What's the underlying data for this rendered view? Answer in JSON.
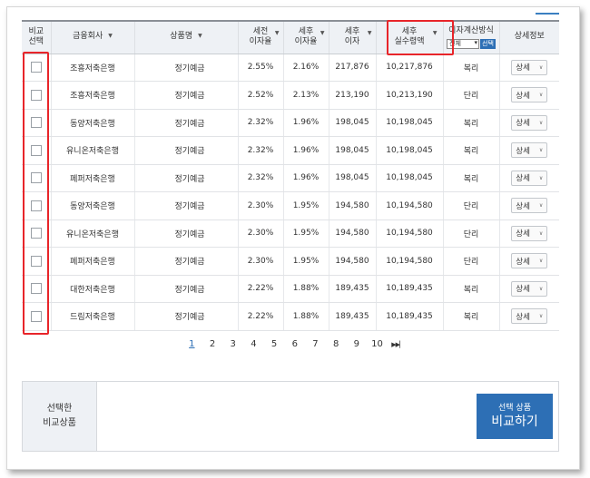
{
  "table": {
    "headers": {
      "compare": [
        "비교",
        "선택"
      ],
      "bank": "금융회사",
      "product": "상품명",
      "pretax_rate": [
        "세전",
        "이자율"
      ],
      "aftertax_rate": [
        "세후",
        "이자율"
      ],
      "aftertax_interest": [
        "세후",
        "이자"
      ],
      "aftertax_received": [
        "세후",
        "실수령액"
      ],
      "calc_method": "이자계산방식",
      "calc_select_value": "전체",
      "calc_select_button": "선택",
      "detail": "상세정보"
    },
    "rows": [
      {
        "bank": "조흥저축은행",
        "product": "정기예금",
        "pretax": "2.55%",
        "aftertax": "2.16%",
        "interest": "217,876",
        "received": "10,217,876",
        "method": "복리",
        "detail": "상세"
      },
      {
        "bank": "조흥저축은행",
        "product": "정기예금",
        "pretax": "2.52%",
        "aftertax": "2.13%",
        "interest": "213,190",
        "received": "10,213,190",
        "method": "단리",
        "detail": "상세"
      },
      {
        "bank": "동양저축은행",
        "product": "정기예금",
        "pretax": "2.32%",
        "aftertax": "1.96%",
        "interest": "198,045",
        "received": "10,198,045",
        "method": "복리",
        "detail": "상세"
      },
      {
        "bank": "유니온저축은행",
        "product": "정기예금",
        "pretax": "2.32%",
        "aftertax": "1.96%",
        "interest": "198,045",
        "received": "10,198,045",
        "method": "복리",
        "detail": "상세"
      },
      {
        "bank": "페퍼저축은행",
        "product": "정기예금",
        "pretax": "2.32%",
        "aftertax": "1.96%",
        "interest": "198,045",
        "received": "10,198,045",
        "method": "복리",
        "detail": "상세"
      },
      {
        "bank": "동양저축은행",
        "product": "정기예금",
        "pretax": "2.30%",
        "aftertax": "1.95%",
        "interest": "194,580",
        "received": "10,194,580",
        "method": "단리",
        "detail": "상세"
      },
      {
        "bank": "유니온저축은행",
        "product": "정기예금",
        "pretax": "2.30%",
        "aftertax": "1.95%",
        "interest": "194,580",
        "received": "10,194,580",
        "method": "단리",
        "detail": "상세"
      },
      {
        "bank": "페퍼저축은행",
        "product": "정기예금",
        "pretax": "2.30%",
        "aftertax": "1.95%",
        "interest": "194,580",
        "received": "10,194,580",
        "method": "단리",
        "detail": "상세"
      },
      {
        "bank": "대한저축은행",
        "product": "정기예금",
        "pretax": "2.22%",
        "aftertax": "1.88%",
        "interest": "189,435",
        "received": "10,189,435",
        "method": "복리",
        "detail": "상세"
      },
      {
        "bank": "드림저축은행",
        "product": "정기예금",
        "pretax": "2.22%",
        "aftertax": "1.88%",
        "interest": "189,435",
        "received": "10,189,435",
        "method": "복리",
        "detail": "상세"
      }
    ]
  },
  "pagination": {
    "pages": [
      "1",
      "2",
      "3",
      "4",
      "5",
      "6",
      "7",
      "8",
      "9",
      "10"
    ],
    "current": "1",
    "next": "▶▶▏"
  },
  "compare": {
    "label_line1": "선택한",
    "label_line2": "비교상품",
    "button_small": "선택 상품",
    "button_big": "비교하기"
  },
  "colors": {
    "accent": "#2d6fb5",
    "highlight": "#e8252a",
    "header_bg": "#eef1f5"
  }
}
